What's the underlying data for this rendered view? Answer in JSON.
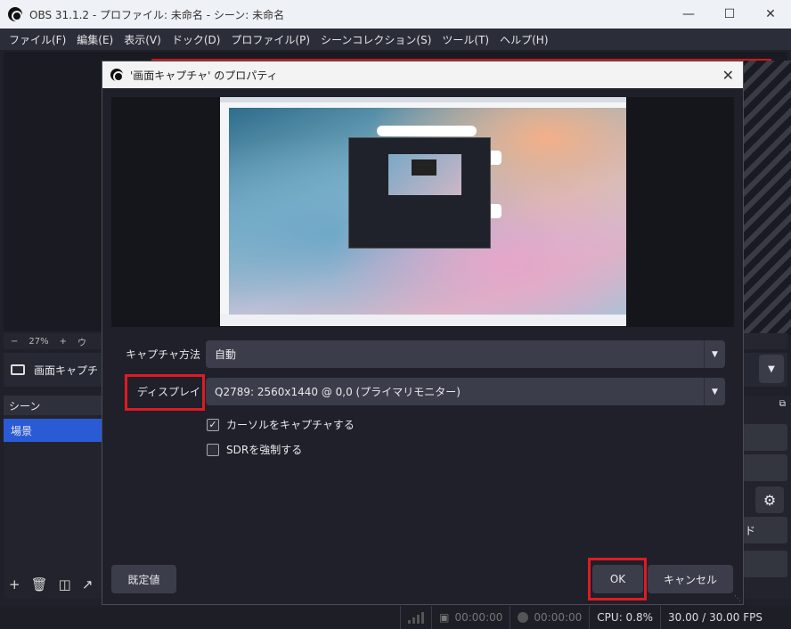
{
  "window": {
    "title": "OBS 31.1.2 - プロファイル: 未命名 - シーン: 未命名"
  },
  "menu": [
    "ファイル(F)",
    "編集(E)",
    "表示(V)",
    "ドック(D)",
    "プロファイル(P)",
    "シーンコレクション(S)",
    "ツール(T)",
    "ヘルプ(H)"
  ],
  "zoom": {
    "minus": "−",
    "value": "27%",
    "plus": "+",
    "more": "ウ"
  },
  "source": {
    "label": "画面キャプチ"
  },
  "scenes": {
    "header": "シーン",
    "item": "場景"
  },
  "right": {
    "frag": "ド"
  },
  "status": {
    "rec_time": "00:00:00",
    "stream_time": "00:00:00",
    "cpu": "CPU: 0.8%",
    "fps": "30.00 / 30.00 FPS"
  },
  "dialog": {
    "title": "'画面キャプチャ' のプロパティ",
    "capture_method_label": "キャプチャ方法",
    "capture_method_value": "自動",
    "display_label": "ディスプレイ",
    "display_value": "Q2789: 2560x1440 @ 0,0 (プライマリモニター)",
    "cursor_label": "カーソルをキャプチャする",
    "cursor_checked": true,
    "sdr_label": "SDRを強制する",
    "sdr_checked": false,
    "defaults_button": "既定値",
    "ok_button": "OK",
    "cancel_button": "キャンセル"
  },
  "colors": {
    "highlight": "#e01a22",
    "accent": "#2b5bd4"
  }
}
